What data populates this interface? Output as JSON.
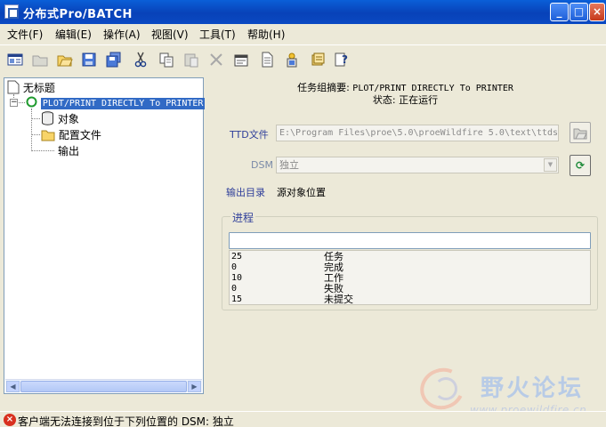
{
  "window": {
    "title": "分布式Pro/BATCH",
    "buttons": {
      "minimize": "_",
      "maximize": "□",
      "close": "×"
    }
  },
  "menu": {
    "items": [
      "文件(F)",
      "编辑(E)",
      "操作(A)",
      "视图(V)",
      "工具(T)",
      "帮助(H)"
    ]
  },
  "toolbar": {
    "buttons": [
      {
        "icon": "window-icon",
        "enabled": true
      },
      {
        "icon": "open-folder-icon",
        "enabled": false
      },
      {
        "icon": "open-icon",
        "enabled": true
      },
      {
        "icon": "save-icon",
        "enabled": true
      },
      {
        "icon": "save-all-icon",
        "enabled": true
      },
      {
        "icon": "cut-icon",
        "enabled": true
      },
      {
        "icon": "copy-icon",
        "enabled": true
      },
      {
        "icon": "paste-icon",
        "enabled": false
      },
      {
        "icon": "delete-icon",
        "enabled": false
      },
      {
        "icon": "properties-icon",
        "enabled": true
      },
      {
        "icon": "document-icon",
        "enabled": true
      },
      {
        "icon": "run-icon",
        "enabled": true
      },
      {
        "icon": "notes-icon",
        "enabled": true
      },
      {
        "icon": "help-icon",
        "enabled": true
      }
    ]
  },
  "tree": {
    "root": "无标题",
    "task": "PLOT/PRINT DIRECTLY To PRINTER",
    "children": [
      "对象",
      "配置文件",
      "输出"
    ]
  },
  "details": {
    "summary_label": "任务组摘要:",
    "summary_value": "PLOT/PRINT DIRECTLY To PRINTER",
    "status_label": "状态:",
    "status_value": "正在运行",
    "ttd_label": "TTD文件",
    "ttd_value": "E:\\Program Files\\proe\\5.0\\proeWildfire 5.0\\text\\ttds",
    "dsm_label": "DSM",
    "dsm_value": "独立",
    "output_label": "输出目录",
    "output_value": "源对象位置"
  },
  "progress": {
    "title": "进程",
    "fraction": 0,
    "stats": [
      {
        "count": "25",
        "name": "任务"
      },
      {
        "count": "0",
        "name": "完成"
      },
      {
        "count": "10",
        "name": "工作"
      },
      {
        "count": "0",
        "name": "失败"
      },
      {
        "count": "15",
        "name": "未提交"
      }
    ]
  },
  "status": {
    "message": "客户端无法连接到位于下列位置的 DSM:",
    "value": "独立"
  },
  "watermark": {
    "title": "野火论坛",
    "url": "www.proewildfire.cn"
  }
}
